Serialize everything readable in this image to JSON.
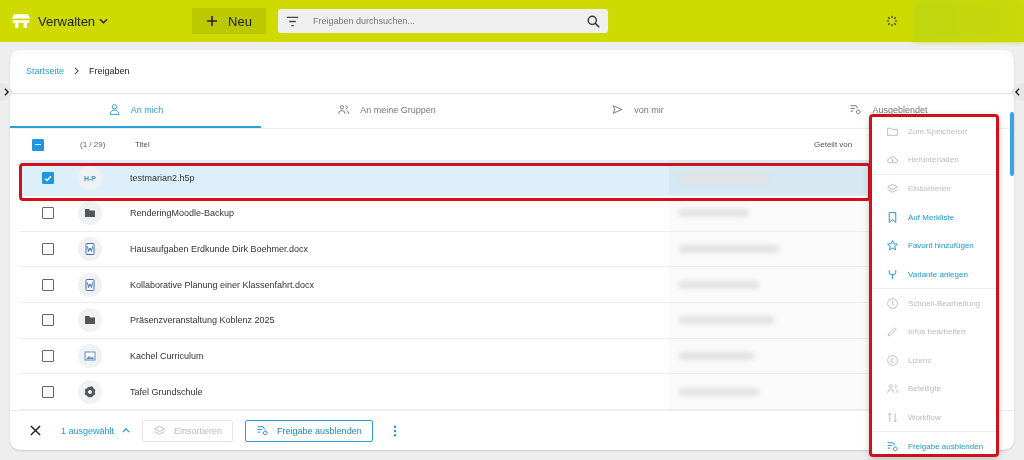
{
  "topbar": {
    "menu_label": "Verwalten",
    "new_button": "Neu",
    "search": {
      "placeholder": "Freigaben durchsuchen..."
    }
  },
  "breadcrumb": [
    {
      "label": "Startseite",
      "link": true
    },
    {
      "label": "Freigaben",
      "link": false
    }
  ],
  "tabs": [
    {
      "label": "An mich",
      "selected": true
    },
    {
      "label": "An meine Gruppen",
      "selected": false
    },
    {
      "label": "von mir",
      "selected": false
    },
    {
      "label": "Ausgeblendet",
      "selected": false
    }
  ],
  "table": {
    "select_all_indeterminate": true,
    "count": "(1 / 29)",
    "columns": [
      "Titel",
      "Geteilt von"
    ],
    "rows": [
      {
        "title": "testmarian2.h5p",
        "kind": "h5p",
        "icon_text": "H-P",
        "checked": true,
        "selected": true
      },
      {
        "title": "RenderingMoodle-Backup",
        "kind": "folder",
        "checked": false,
        "selected": false
      },
      {
        "title": "Hausaufgaben Erdkunde Dirk Boehmer.docx",
        "kind": "word",
        "checked": false,
        "selected": false
      },
      {
        "title": "Kollaborative Planung einer Klassenfahrt.docx",
        "kind": "word",
        "checked": false,
        "selected": false
      },
      {
        "title": "Präsenzveranstaltung Koblenz 2025",
        "kind": "folder",
        "checked": false,
        "selected": false
      },
      {
        "title": "Kachel Curriculum",
        "kind": "image",
        "checked": false,
        "selected": false
      },
      {
        "title": "Tafel Grundschule",
        "kind": "other",
        "checked": false,
        "selected": false
      }
    ]
  },
  "bottom_bar": {
    "selection": "1 ausgewählt",
    "buttons": [
      {
        "label": "Einsortieren",
        "disabled": true
      },
      {
        "label": "Freigabe ausblenden",
        "disabled": false
      }
    ]
  },
  "context_menu": {
    "groups": [
      [
        {
          "label": "Zum Speicherort",
          "disabled": true
        },
        {
          "label": "Herunterladen",
          "disabled": true
        }
      ],
      [
        {
          "label": "Einsortieren",
          "disabled": true
        },
        {
          "label": "Auf Merkliste",
          "disabled": false
        },
        {
          "label": "Favorit hinzufügen",
          "disabled": false
        },
        {
          "label": "Variante anlegen",
          "disabled": false
        }
      ],
      [
        {
          "label": "Schnell-Bearbeitung",
          "disabled": true
        },
        {
          "label": "Infos bearbeiten",
          "disabled": true
        },
        {
          "label": "Lizenz",
          "disabled": true
        },
        {
          "label": "Beteiligte",
          "disabled": true
        },
        {
          "label": "Workflow",
          "disabled": true
        }
      ],
      [
        {
          "label": "Freigabe ausblenden",
          "disabled": false
        }
      ]
    ]
  }
}
